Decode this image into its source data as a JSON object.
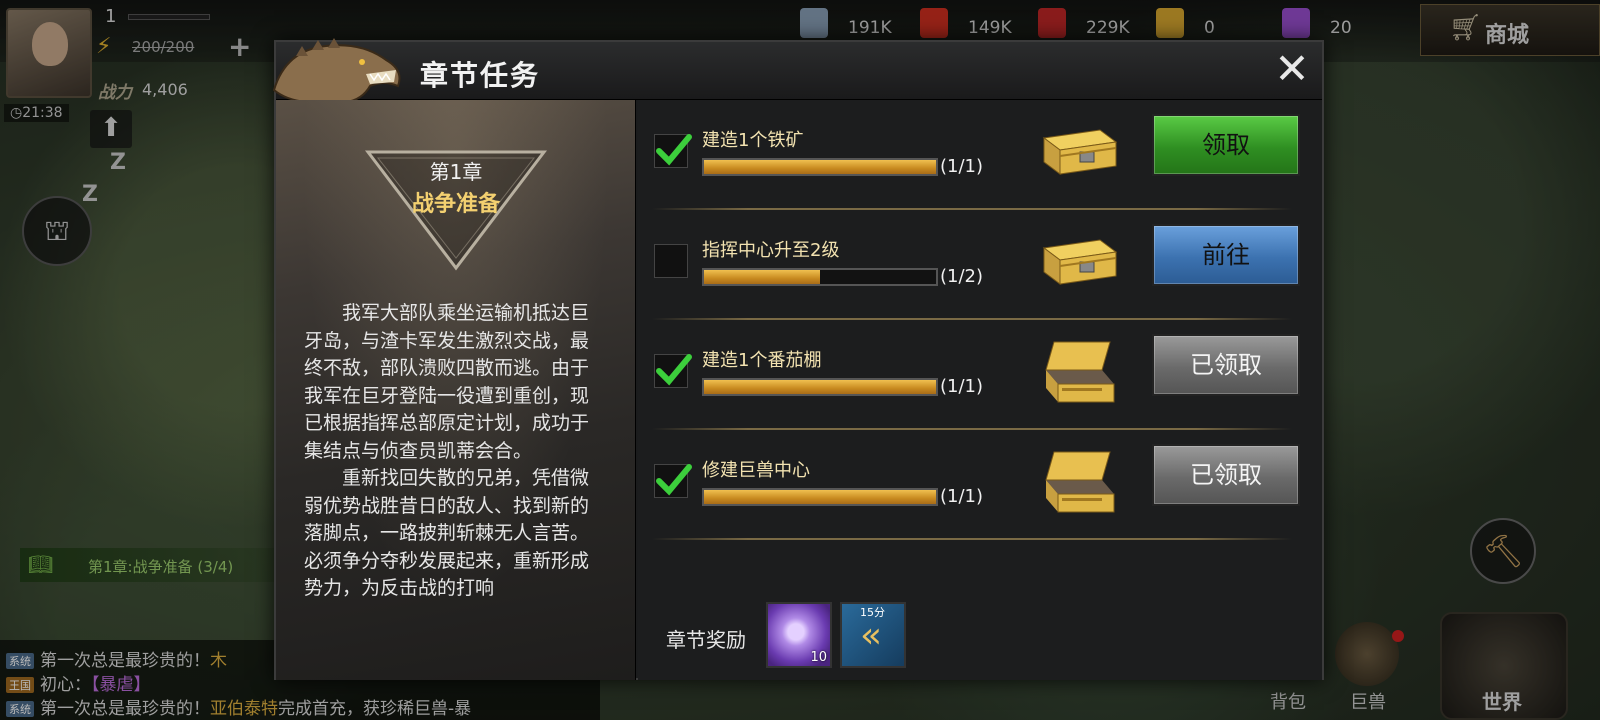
{
  "hud": {
    "level": "1",
    "energy": "200/200",
    "plus": "+",
    "power_label": "战力",
    "power_value": "4,406",
    "timer": "◷21:38",
    "resources": [
      {
        "icon": "steel-icon",
        "value": "191K",
        "color": "#8aa0b8"
      },
      {
        "icon": "tomato-icon",
        "value": "149K",
        "color": "#d03020"
      },
      {
        "icon": "fuel-can-icon",
        "value": "229K",
        "color": "#c02828"
      },
      {
        "icon": "gold-bar-icon",
        "value": "0",
        "color": "#d8a830"
      },
      {
        "icon": "diamond-icon",
        "value": "20",
        "color": "#9a50d0"
      }
    ],
    "shop_label": "商城",
    "chapter_tracker": "第1章:战争准备 (3/4)",
    "bag_label": "背包",
    "beast_label": "巨兽",
    "world_label": "世界"
  },
  "chat": [
    {
      "tag": "系统",
      "tag_type": "sys",
      "text": "第一次总是最珍贵的！",
      "highlight": "木"
    },
    {
      "tag": "王国",
      "tag_type": "king",
      "text": "初心：",
      "highlight": "【暴虐】"
    },
    {
      "tag": "系统",
      "tag_type": "sys",
      "text": "第一次总是最珍贵的！",
      "highlight": "亚伯泰特",
      "suffix": "完成首充，获珍稀巨兽-暴"
    }
  ],
  "dialog": {
    "title": "章节任务",
    "close": "✕",
    "chapter_number": "第1章",
    "chapter_name": "战争准备",
    "story": "　　我军大部队乘坐运输机抵达巨牙岛，与渣卡军发生激烈交战，最终不敌，部队溃败四散而逃。由于我军在巨牙登陆一役遭到重创，现已根据指挥总部原定计划，成功于集结点与侦查员凯蒂会合。\n　　重新找回失散的兄弟，凭借微弱优势战胜昔日的敌人、找到新的落脚点，一路披荆斩棘无人言苦。必须争分夺秒发展起来，重新形成势力，为反击战的打响",
    "tasks": [
      {
        "name": "建造1个铁矿",
        "progress": 1.0,
        "progress_text": "(1/1)",
        "checked": true,
        "chest": "closed",
        "action": "领取",
        "action_type": "claim"
      },
      {
        "name": "指挥中心升至2级",
        "progress": 0.5,
        "progress_text": "(1/2)",
        "checked": false,
        "chest": "closed",
        "action": "前往",
        "action_type": "go"
      },
      {
        "name": "建造1个番茄棚",
        "progress": 1.0,
        "progress_text": "(1/1)",
        "checked": true,
        "chest": "open",
        "action": "已领取",
        "action_type": "done"
      },
      {
        "name": "修建巨兽中心",
        "progress": 1.0,
        "progress_text": "(1/1)",
        "checked": true,
        "chest": "open",
        "action": "已领取",
        "action_type": "done"
      }
    ],
    "reward_label": "章节奖励",
    "rewards": [
      {
        "icon": "diamond-ore-icon",
        "count": "10"
      },
      {
        "icon": "speedup-icon",
        "top_text": "15分"
      }
    ]
  }
}
